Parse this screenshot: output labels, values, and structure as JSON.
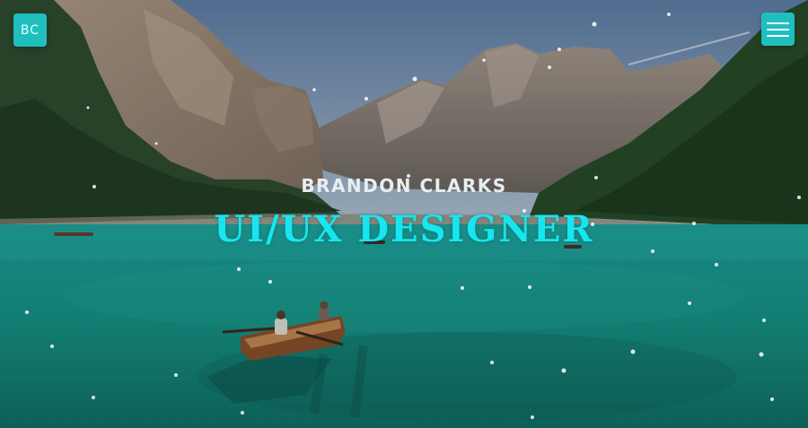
{
  "header": {
    "logo_text": "BC",
    "menu_icon": "hamburger-menu-icon"
  },
  "hero": {
    "name": "BRANDON CLARKS",
    "title": "UI/UX DESIGNER",
    "background": "lake-and-mountains-photo"
  },
  "colors": {
    "accent": "#1fbfbf",
    "title": "#16e6f0",
    "name": "#e6eef0"
  }
}
